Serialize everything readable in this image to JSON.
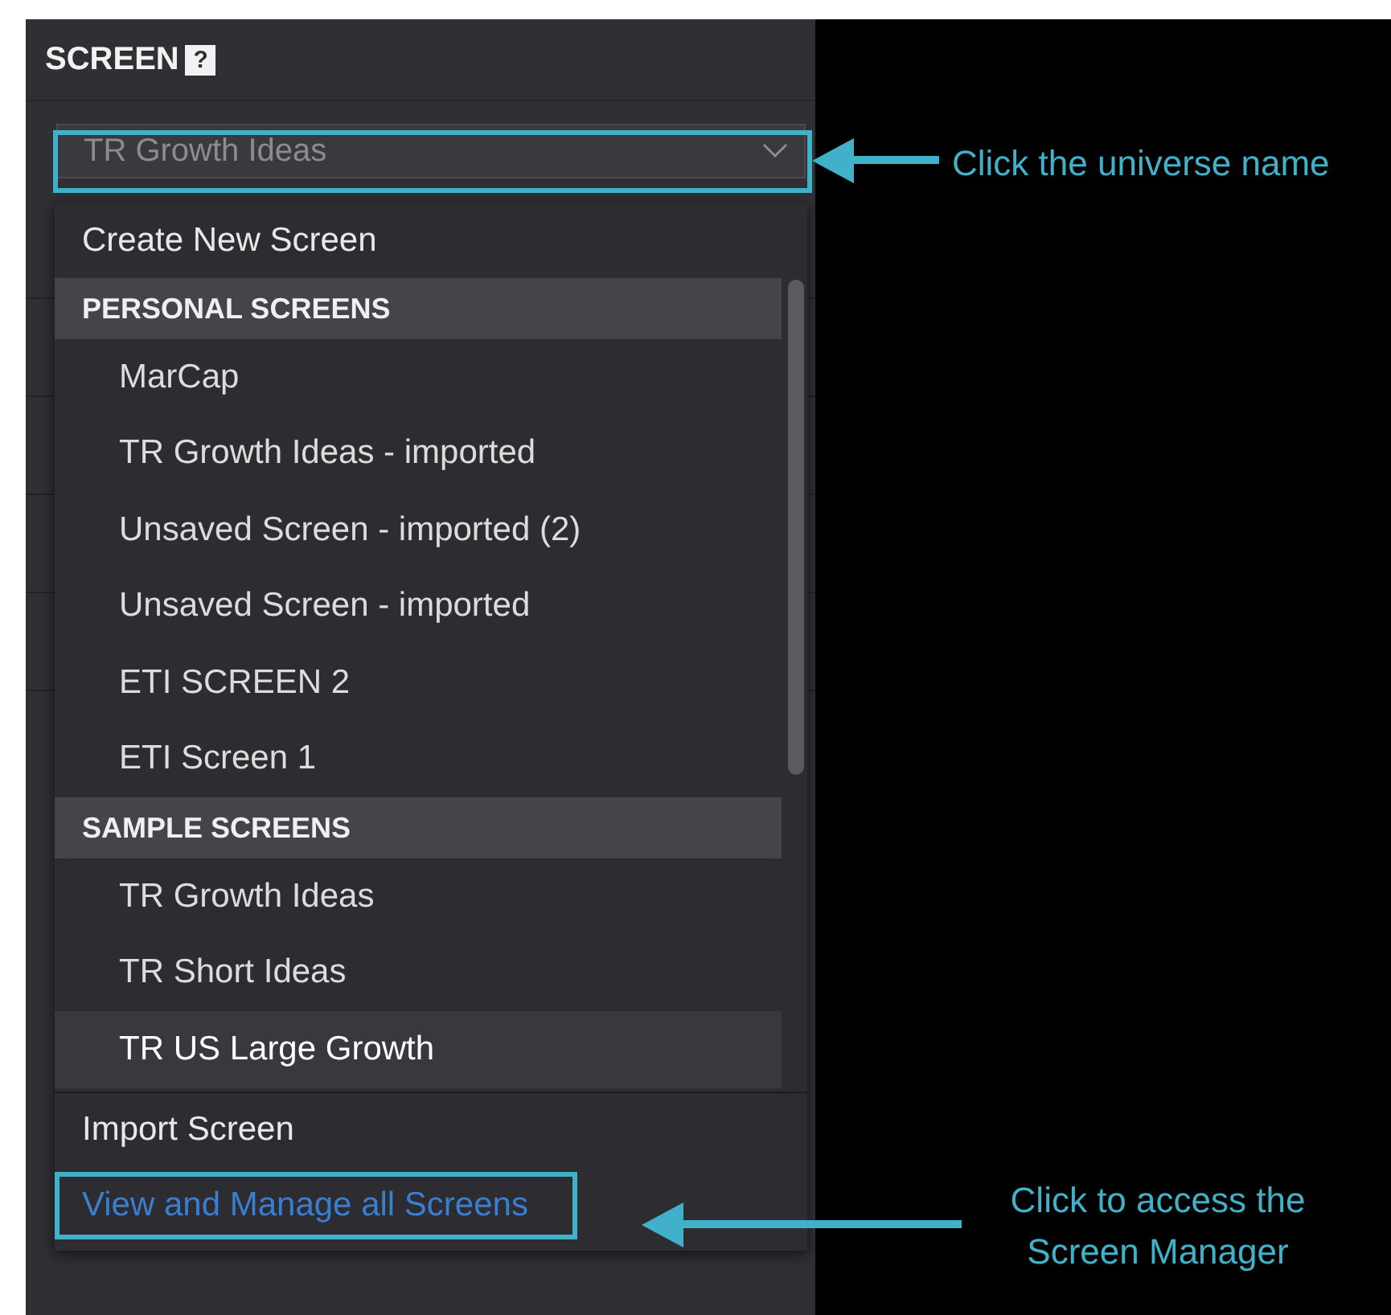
{
  "panel": {
    "title": "SCREEN",
    "help_icon": "?"
  },
  "dropdown": {
    "value": "TR Growth Ideas"
  },
  "menu": {
    "items": [
      {
        "kind": "action",
        "label": "Create New Screen"
      },
      {
        "kind": "header",
        "label": "PERSONAL SCREENS"
      },
      {
        "kind": "screen",
        "label": "MarCap",
        "selected": false
      },
      {
        "kind": "screen",
        "label": "TR Growth Ideas - imported",
        "selected": false
      },
      {
        "kind": "screen",
        "label": "Unsaved Screen - imported (2)",
        "selected": false
      },
      {
        "kind": "screen",
        "label": "Unsaved Screen - imported",
        "selected": false
      },
      {
        "kind": "screen",
        "label": "ETI SCREEN 2",
        "selected": false
      },
      {
        "kind": "screen",
        "label": "ETI Screen 1",
        "selected": false
      },
      {
        "kind": "header",
        "label": "SAMPLE SCREENS"
      },
      {
        "kind": "screen",
        "label": "TR Growth Ideas",
        "selected": false
      },
      {
        "kind": "screen",
        "label": "TR Short Ideas",
        "selected": false
      },
      {
        "kind": "screen",
        "label": "TR US Large Growth",
        "selected": true
      },
      {
        "kind": "divider"
      },
      {
        "kind": "action",
        "label": "Import Screen"
      },
      {
        "kind": "link",
        "label": "View and Manage all Screens"
      }
    ]
  },
  "annotations": [
    {
      "text": "Click the universe name"
    },
    {
      "text": "Click to access the Screen Manager"
    }
  ]
}
